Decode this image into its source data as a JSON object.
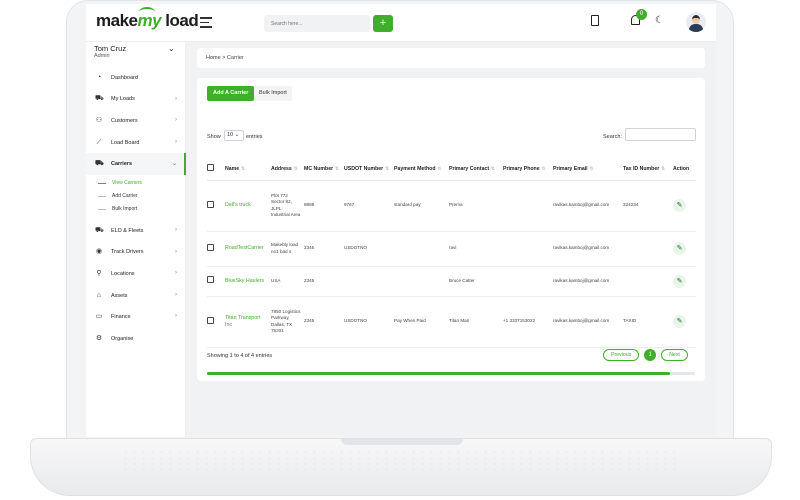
{
  "app": {
    "logo_prefix": "make",
    "logo_highlight": "my",
    "logo_suffix": " load"
  },
  "topbar": {
    "search_placeholder": "Search here...",
    "search_button": "+",
    "notification_count": "0"
  },
  "user": {
    "name": "Tom Cruz",
    "role": "Admin"
  },
  "sidebar": {
    "items": [
      {
        "label": "Dashboard",
        "icon": "dashboard-icon"
      },
      {
        "label": "My Loads",
        "icon": "truck-icon"
      },
      {
        "label": "Customers",
        "icon": "users-icon"
      },
      {
        "label": "Load Board",
        "icon": "chart-icon"
      },
      {
        "label": "Carriers",
        "icon": "carrier-icon"
      },
      {
        "label": "ELD & Fleets",
        "icon": "fleet-icon"
      },
      {
        "label": "Track Drivers",
        "icon": "location-pin-icon"
      },
      {
        "label": "Locations",
        "icon": "map-pin-icon"
      },
      {
        "label": "Assets",
        "icon": "briefcase-icon"
      },
      {
        "label": "Finance",
        "icon": "calendar-icon"
      },
      {
        "label": "Organise",
        "icon": "settings-icon"
      }
    ],
    "carrier_sub": [
      "View Carriers",
      "Add Carrier",
      "Bulk Import"
    ]
  },
  "breadcrumb": "Home > Carrier",
  "toolbar": {
    "add_label": "Add A Carrier",
    "bulk_label": "Bulk Import"
  },
  "table_controls": {
    "show": "Show",
    "page_size": "10",
    "entries": "entries",
    "search": "Search:"
  },
  "table": {
    "headers": [
      "Name",
      "Address",
      "MC Number",
      "USDOT Number",
      "Payment Method",
      "Primary Contact",
      "Primary Phone",
      "Primary Email",
      "Tax ID Number",
      "Action"
    ],
    "rows": [
      {
        "name": "Dell's truck",
        "address": "Plot 772 Sector 82, JLPL Industrial Area",
        "mc": "8888",
        "usdot": "9767",
        "payment": "standard pay",
        "contact": "Prema",
        "phone": "",
        "email": "ravikas.kamboj@gmail.com",
        "tax": "324234"
      },
      {
        "name": "RoadTestCarrier",
        "address": "Makebly load no1 bad s",
        "mc": "2345",
        "usdot": "USDOTNO",
        "payment": "",
        "contact": "ravi",
        "phone": "",
        "email": "ravikas.kamboj@gmail.com",
        "tax": ""
      },
      {
        "name": "BlueSky Haulers",
        "address": "USA",
        "mc": "2345",
        "usdot": "",
        "payment": "",
        "contact": "Bruce Catter",
        "phone": "",
        "email": "ravikas.kamboj@gmail.com",
        "tax": ""
      },
      {
        "name": "Titan Transport Inc",
        "address": "7850 Logistics Parkway, Dallas, TX 75201",
        "mc": "2345",
        "usdot": "USDOTNO",
        "payment": "Pay When Paid",
        "contact": "Titan Man",
        "phone": "+1 3337153022",
        "email": "ravikas.kamboj@gmail.com",
        "tax": "TAXID"
      }
    ]
  },
  "footer": {
    "showing": "Showing 1 to 4 of 4 entries",
    "previous": "Previous",
    "page": "1",
    "next": "Next"
  },
  "colors": {
    "accent": "#3fae2a"
  }
}
